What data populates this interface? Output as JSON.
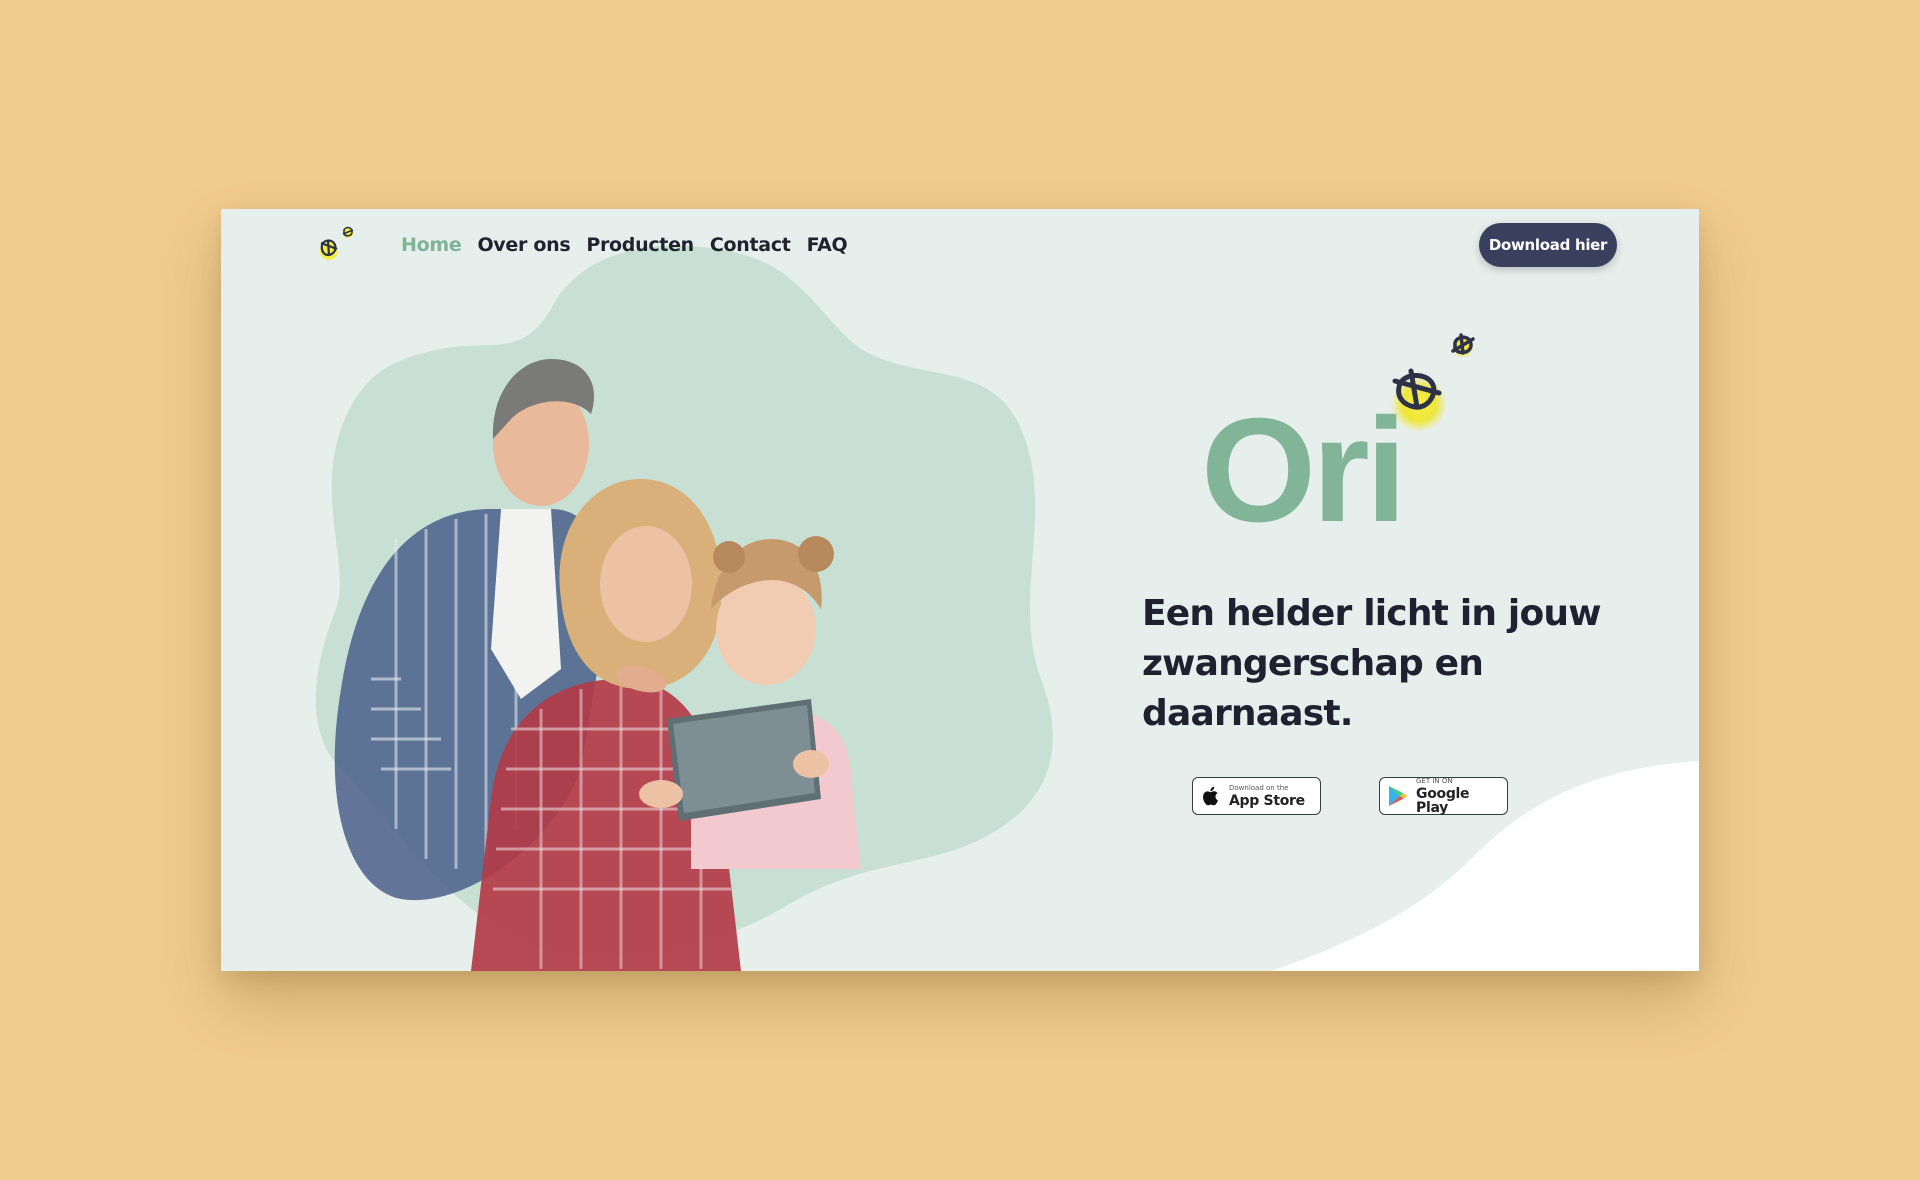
{
  "nav": {
    "links": [
      {
        "label": "Home",
        "active": true
      },
      {
        "label": "Over ons",
        "active": false
      },
      {
        "label": "Producten",
        "active": false
      },
      {
        "label": "Contact",
        "active": false
      },
      {
        "label": "FAQ",
        "active": false
      }
    ],
    "cta_label": "Download hier"
  },
  "hero": {
    "brand_word": "Ori",
    "tagline": "Een helder licht in jouw zwangerschap en daarnaast.",
    "image_alt_name": "family-with-tablet-photo"
  },
  "stores": {
    "apple": {
      "small": "Download on the",
      "big": "App Store",
      "icon": "apple-icon"
    },
    "google": {
      "small": "GET IN ON",
      "big": "Google Play",
      "icon": "google-play-icon"
    }
  },
  "colors": {
    "page_background": "#f1cc8f",
    "site_background": "#e6efeb",
    "blob": "#c8e0d4",
    "accent_green": "#82b597",
    "nav_active": "#7eb395",
    "cta_background": "#3a3f5e",
    "firefly_glow": "#f2ec3a",
    "text_dark": "#1e2230"
  }
}
